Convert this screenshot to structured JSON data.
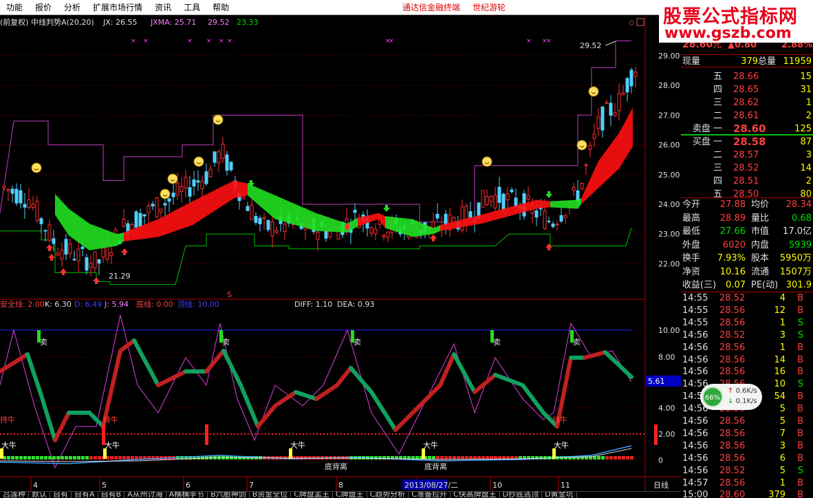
{
  "menu": [
    "功能",
    "报价",
    "分析",
    "扩展市场行情",
    "资讯",
    "工具",
    "帮助"
  ],
  "menu_links": [
    "通达信金融终端",
    "世纪游轮"
  ],
  "watermark": {
    "line1": "股票公式指标网",
    "line2": "www.gszb.com"
  },
  "main_indicator": {
    "label": "(前复权) 中线判势A(20,20)",
    "jx": "JX: 26.55",
    "jxma": "JXMA: 25.71",
    "extra1": "29.52",
    "extra2": "23.33"
  },
  "price_axis": [
    "29.00",
    "28.00",
    "27.00",
    "26.00",
    "25.00",
    "24.00",
    "23.00",
    "22.00"
  ],
  "chart_labels": {
    "high": "29.52",
    "low": "21.29",
    "s": "S"
  },
  "sub_indicator": {
    "anquan": "安全线: 2.00",
    "k": "K: 6.30",
    "d": "D: 6.49",
    "j": "J: 5.94",
    "dixian": "底线: 0.00",
    "dingxian": "顶线: 10.00",
    "diff": "DIFF: 1.10",
    "dea": "DEA: 0.93"
  },
  "sub_axis": [
    "10.00",
    "8.00",
    "4.00",
    "2.00",
    "0"
  ],
  "sub_current": "5.61",
  "sub_labels": {
    "sell": "卖",
    "bull": "大牛",
    "hold": "持牛",
    "divergence": "底背离"
  },
  "date_axis": [
    "4",
    "5",
    "6",
    "7",
    "8",
    "9",
    "10",
    "11"
  ],
  "date_highlight": "2013/08/27/二",
  "period_label": "日线",
  "quote": {
    "price": "28.60",
    "unit": "元",
    "change": "▲0.80",
    "pct": "2.88%",
    "xianliang_label": "现量",
    "xianliang": "379",
    "zongliang_label": "总量",
    "zongliang": "11959",
    "sell": [
      {
        "l": "五",
        "p": "28.66",
        "v": "15"
      },
      {
        "l": "四",
        "p": "28.65",
        "v": "31"
      },
      {
        "l": "三",
        "p": "28.62",
        "v": "1"
      },
      {
        "l": "二",
        "p": "28.61",
        "v": "2"
      },
      {
        "l": "卖盘 一",
        "p": "28.60",
        "v": "125"
      }
    ],
    "buy": [
      {
        "l": "买盘 一",
        "p": "28.58",
        "v": "87"
      },
      {
        "l": "二",
        "p": "28.57",
        "v": "3"
      },
      {
        "l": "三",
        "p": "28.52",
        "v": "14"
      },
      {
        "l": "四",
        "p": "28.51",
        "v": "2"
      },
      {
        "l": "五",
        "p": "28.50",
        "v": "80"
      }
    ],
    "stats": [
      {
        "a": "今开",
        "av": "27.88",
        "b": "均价",
        "bv": "28.34"
      },
      {
        "a": "最高",
        "av": "28.89",
        "b": "量比",
        "bv": "0.68"
      },
      {
        "a": "最低",
        "av": "27.66",
        "b": "市值",
        "bv": "17.0亿"
      },
      {
        "a": "外盘",
        "av": "6020",
        "b": "内盘",
        "bv": "5939"
      },
      {
        "a": "换手",
        "av": "7.93%",
        "b": "股本",
        "bv": "5950万"
      },
      {
        "a": "净资",
        "av": "10.16",
        "b": "流通",
        "bv": "1507万"
      },
      {
        "a": "收益(三)",
        "av": "0.07",
        "b": "PE(动)",
        "bv": "301.9"
      }
    ],
    "ticks": [
      {
        "t": "14:55",
        "p": "28.52",
        "v": "4",
        "s": "B"
      },
      {
        "t": "14:55",
        "p": "28.56",
        "v": "12",
        "s": "B"
      },
      {
        "t": "14:55",
        "p": "28.56",
        "v": "1",
        "s": "S"
      },
      {
        "t": "14:56",
        "p": "28.52",
        "v": "3",
        "s": "S"
      },
      {
        "t": "14:56",
        "p": "28.56",
        "v": "1",
        "s": "B"
      },
      {
        "t": "14:56",
        "p": "28.56",
        "v": "14",
        "s": "B"
      },
      {
        "t": "14:56",
        "p": "28.56",
        "v": "16",
        "s": "B"
      },
      {
        "t": "14:56",
        "p": "28.56",
        "v": "10",
        "s": "S"
      },
      {
        "t": "14:56",
        "p": "28.56",
        "v": "54",
        "s": "B"
      },
      {
        "t": "14:56",
        "p": "28.56",
        "v": "5",
        "s": "B"
      },
      {
        "t": "14:56",
        "p": "28.56",
        "v": "5",
        "s": "B"
      },
      {
        "t": "14:56",
        "p": "28.56",
        "v": "7",
        "s": "B"
      },
      {
        "t": "14:56",
        "p": "28.56",
        "v": "3",
        "s": "B"
      },
      {
        "t": "14:56",
        "p": "28.56",
        "v": "6",
        "s": "B"
      },
      {
        "t": "14:56",
        "p": "28.52",
        "v": "5",
        "s": "S"
      },
      {
        "t": "14:57",
        "p": "28.56",
        "v": "1",
        "s": "B"
      },
      {
        "t": "15:00",
        "p": "28.60",
        "v": "379",
        "s": "B"
      }
    ]
  },
  "network": {
    "pct": "66%",
    "up": "0.6K/s",
    "down": "0.1K/s"
  },
  "tabs": [
    "吕莲种",
    "默认",
    "自有",
    "自有A",
    "自有B",
    "A从州讨海",
    "A横横李节",
    "B六胎神剑",
    "B资金全位",
    "C牌盘孟王",
    "C牌盘王",
    "C趋势分析",
    "C准备拉升",
    "C快高牌盘王",
    "D抄底逃顶",
    "D黄金坑"
  ]
}
